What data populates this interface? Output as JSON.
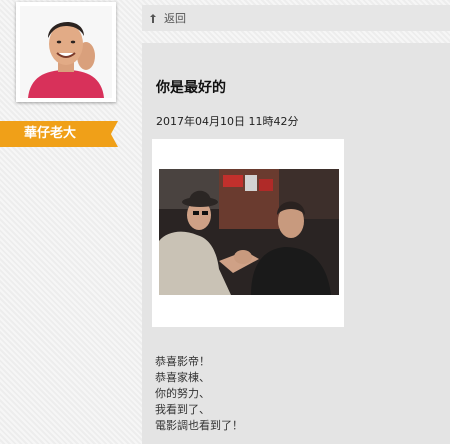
{
  "profile": {
    "name": "華仔老大"
  },
  "nav": {
    "back_label": "返回"
  },
  "post": {
    "title": "你是最好的",
    "datetime": "2017年04月10日 11時42分",
    "body_lines": [
      "恭喜影帝！",
      "恭喜家棟、",
      "你的努力、",
      "我看到了、",
      "電影調也看到了！"
    ]
  },
  "colors": {
    "ribbon": "#f0a018",
    "avatar_shirt": "#d8315a"
  },
  "icons": {
    "back": "arrow-up-left-icon"
  }
}
